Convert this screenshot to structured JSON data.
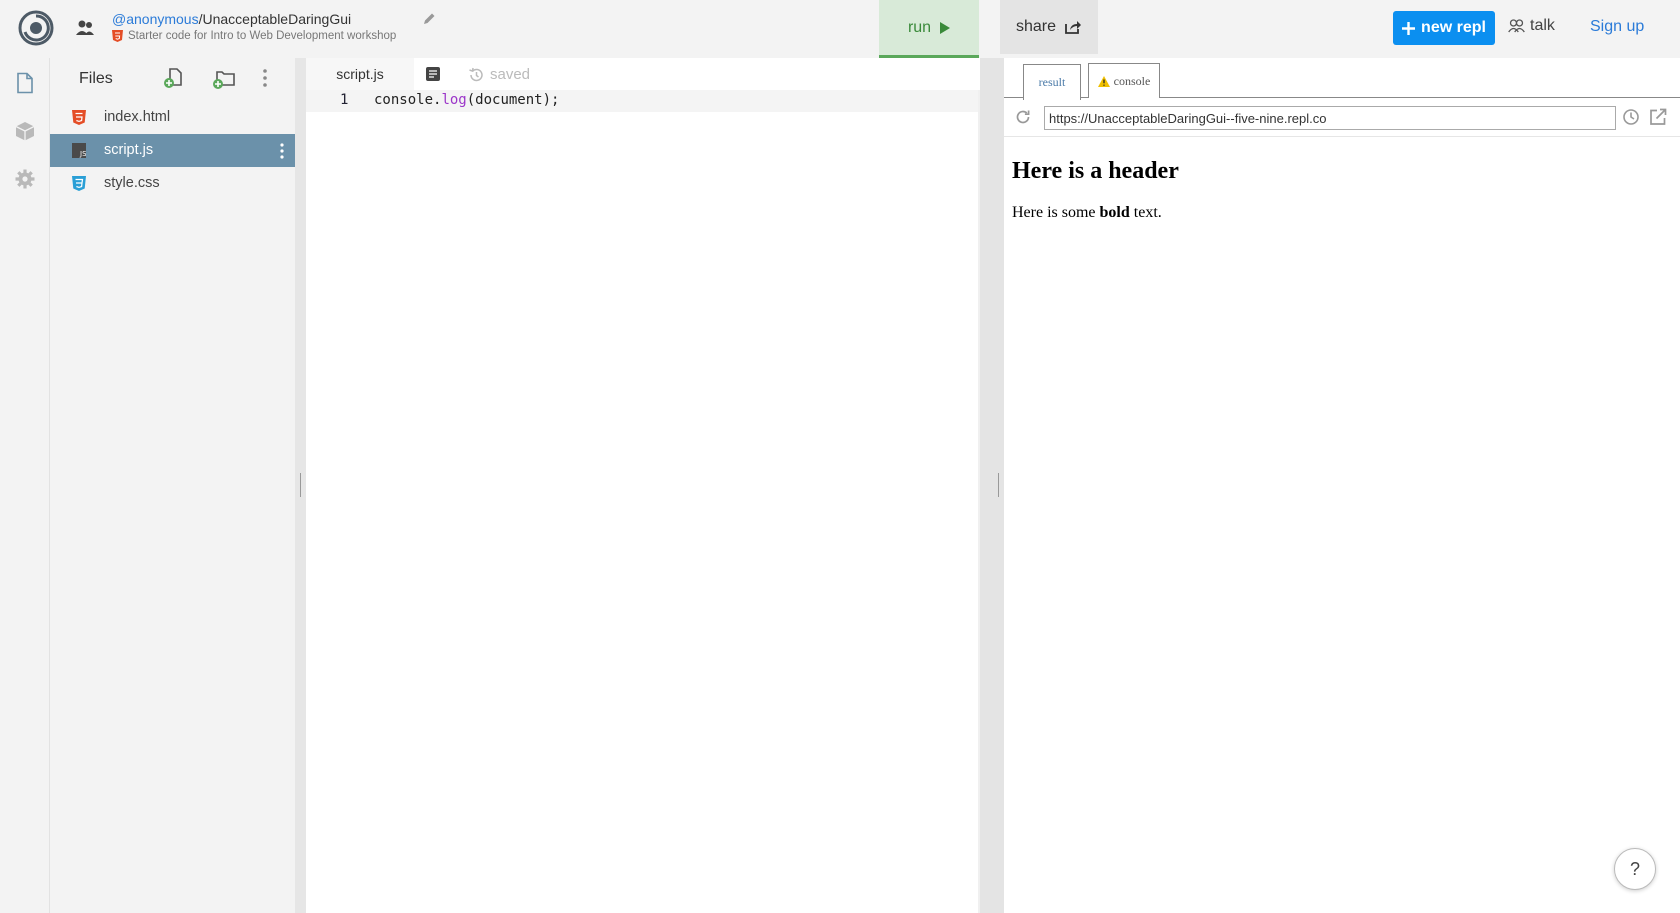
{
  "header": {
    "owner": "@anonymous",
    "separator": "/",
    "repl_name": "UnacceptableDaringGui",
    "description": "Starter code for Intro to Web Development workshop",
    "run_label": "run",
    "share_label": "share",
    "new_repl_label": "new repl",
    "talk_label": "talk",
    "signup_label": "Sign up"
  },
  "files": {
    "title": "Files",
    "items": [
      {
        "name": "index.html",
        "icon": "html5-icon",
        "active": false
      },
      {
        "name": "script.js",
        "icon": "js-file-icon",
        "active": true
      },
      {
        "name": "style.css",
        "icon": "css3-icon",
        "active": false
      }
    ]
  },
  "editor": {
    "tab_label": "script.js",
    "status": "saved",
    "line_number": "1",
    "code_prefix": "console.",
    "code_fn": "log",
    "code_suffix": "(document);"
  },
  "output": {
    "tab_result": "result",
    "tab_console": "console",
    "url": "https://UnacceptableDaringGui--five-nine.repl.co",
    "page_header": "Here is a header",
    "page_text_before": "Here is some ",
    "page_text_bold": "bold",
    "page_text_after": " text."
  },
  "help_label": "?",
  "colors": {
    "accent": "#0b8ff0",
    "run_bg": "#d8ead8",
    "run_fg": "#3a8a3a",
    "active_file_bg": "#6b91aa",
    "link": "#2b7bd8"
  }
}
